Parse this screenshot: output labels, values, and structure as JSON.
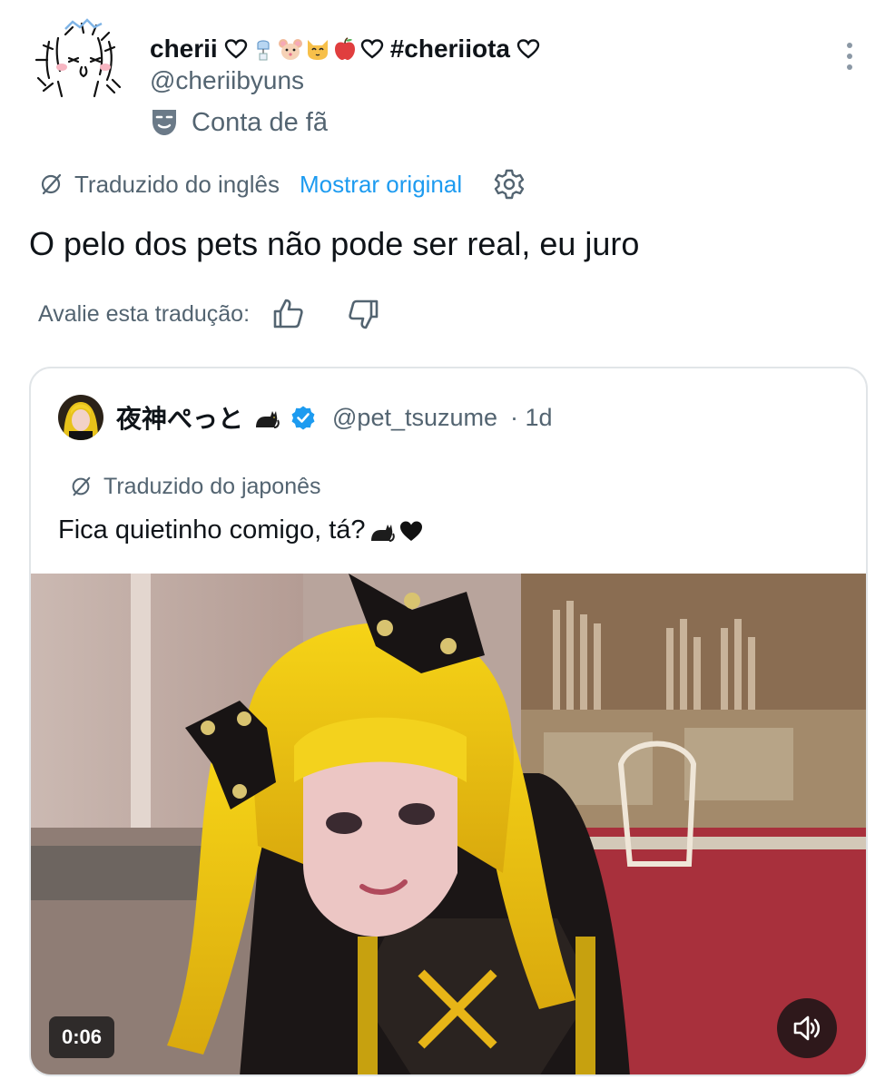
{
  "author": {
    "name": "cherii",
    "hashtag": "#cheriiota",
    "handle": "@cheriibyuns",
    "fan_label": "Conta de fã"
  },
  "translation": {
    "label": "Traduzido do inglês",
    "show_original": "Mostrar original"
  },
  "post_text": "O pelo dos pets não pode ser real, eu juro",
  "rating": {
    "label": "Avalie esta tradução:"
  },
  "quote": {
    "name": "夜神ぺっと",
    "handle": "@pet_tsuzume",
    "time": "· 1d",
    "translated_label": "Traduzido do japonês",
    "text": "Fica quietinho comigo, tá?",
    "video_time": "0:06"
  },
  "icons": {
    "fan": "theater-mask-icon",
    "translate": "translate-slash-icon",
    "settings": "gear-icon",
    "like": "thumbs-up-icon",
    "dislike": "thumbs-down-icon",
    "verified": "verified-badge-icon",
    "volume": "speaker-icon",
    "more": "more-vertical-icon"
  },
  "colors": {
    "link": "#1d9bf0",
    "secondary": "#536471",
    "verified": "#1d9bf0",
    "border": "#e1e5e8"
  }
}
